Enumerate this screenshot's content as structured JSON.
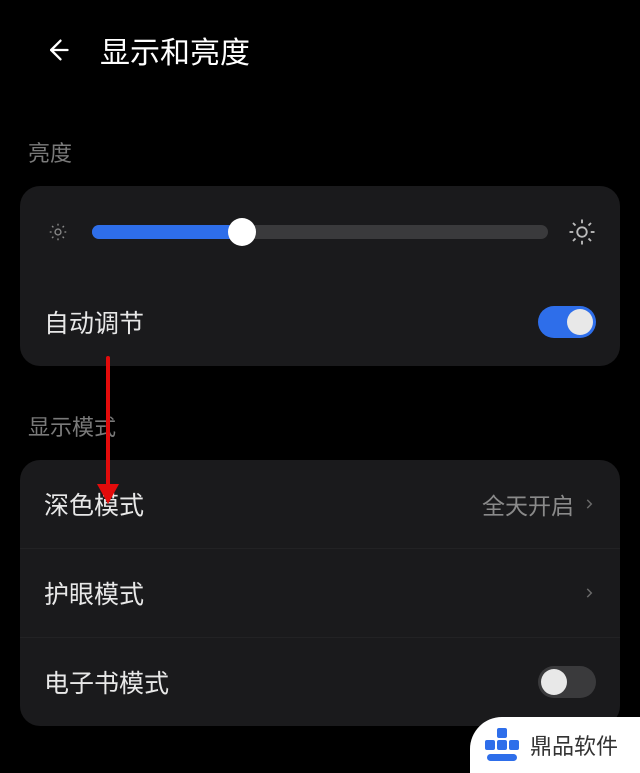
{
  "header": {
    "title": "显示和亮度"
  },
  "brightness": {
    "section_label": "亮度",
    "slider_percent": 33,
    "auto_label": "自动调节",
    "auto_on": true
  },
  "display_mode": {
    "section_label": "显示模式",
    "dark": {
      "label": "深色模式",
      "value": "全天开启"
    },
    "eyecare": {
      "label": "护眼模式"
    },
    "ebook": {
      "label": "电子书模式",
      "on": false
    }
  },
  "watermark": {
    "text": "鼎品软件"
  }
}
